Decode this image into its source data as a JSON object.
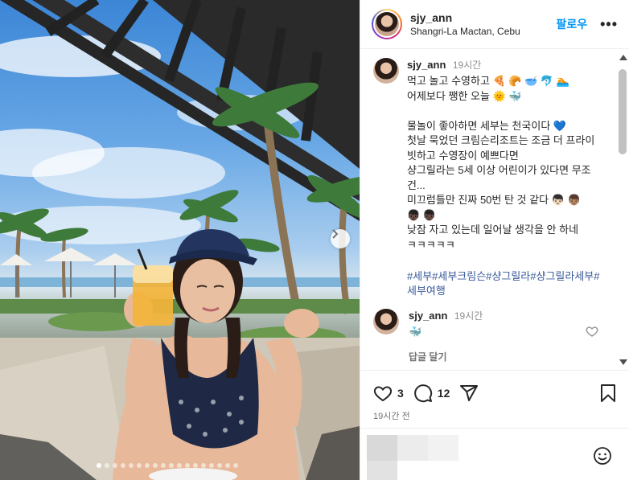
{
  "post": {
    "username": "sjy_ann",
    "location": "Shangri-La Mactan, Cebu",
    "follow_label": "팔로우",
    "more_label": "•••",
    "caption_user": "sjy_ann",
    "caption_time": "19시간",
    "caption": "먹고 놀고 수영하고 🍕 🥐 🥣 🐬 🏊\n어제보다 쨍한 오늘 🌞 🐳\n\n물놀이 좋아하면 세부는 천국이다 💙\n첫날 묵었던 크림슨리조트는 조금 더 프라이빗하고 수영장이 예쁘다면\n샹그릴라는 5세 이상 어린이가 있다면 무조건...\n미끄럼틀만 진짜 50번 탄 것 같다 👦🏻 👦🏽\n👦🏿 👦🏿\n낮잠 자고 있는데 일어날 생각을 안 하네\nㅋㅋㅋㅋㅋ",
    "hashtags": "#세부#세부크림슨#샹그릴라#샹그릴라세부#세부여행",
    "comment": {
      "user": "sjy_ann",
      "time": "19시간",
      "text": "🐳",
      "reply_label": "답글 달기"
    },
    "likes_count": "3",
    "comments_count": "12",
    "posted_time": "19시간 전"
  },
  "icons": {
    "heart": "heart-icon",
    "comment": "comment-icon",
    "share": "paper-plane-icon",
    "bookmark": "bookmark-icon",
    "emoji": "emoji-icon",
    "next": "chevron-right-icon"
  },
  "colors": {
    "follow_blue": "#0095f6",
    "hashtag_blue": "#385898",
    "muted": "#737373"
  },
  "carousel": {
    "total_slides": 18,
    "active_slide": 1
  }
}
